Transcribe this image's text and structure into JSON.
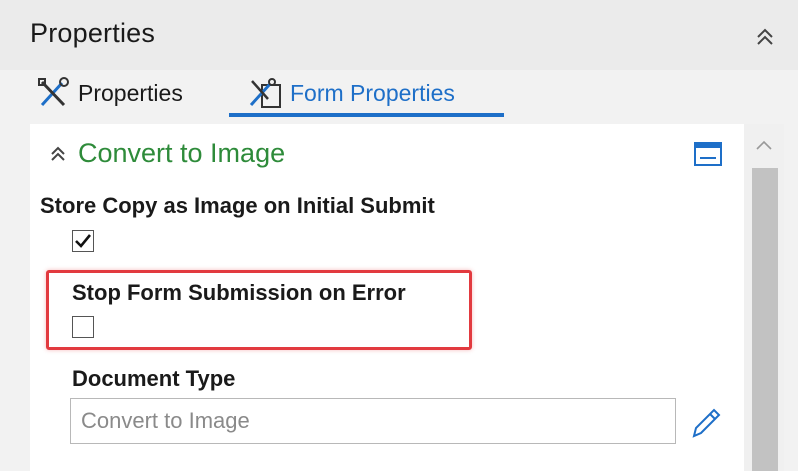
{
  "header": {
    "title": "Properties",
    "collapse_icon": "double-chevron-up-icon"
  },
  "tabs": [
    {
      "label": "Properties",
      "icon": "tools-icon",
      "active": false
    },
    {
      "label": "Form Properties",
      "icon": "form-properties-icon",
      "active": true
    }
  ],
  "section": {
    "title": "Convert to Image",
    "collapse_icon": "double-chevron-up-icon",
    "panel_icon": "panel-icon"
  },
  "fields": {
    "store_copy": {
      "label": "Store Copy as Image on Initial Submit",
      "checked": true
    },
    "stop_submission": {
      "label": "Stop Form Submission on Error",
      "checked": false,
      "highlighted": true
    },
    "document_type": {
      "label": "Document Type",
      "placeholder": "Convert to Image",
      "value": ""
    }
  },
  "colors": {
    "accent_blue": "#1e6fc8",
    "section_green": "#2e8b3a",
    "highlight_red": "#e23a3f"
  }
}
